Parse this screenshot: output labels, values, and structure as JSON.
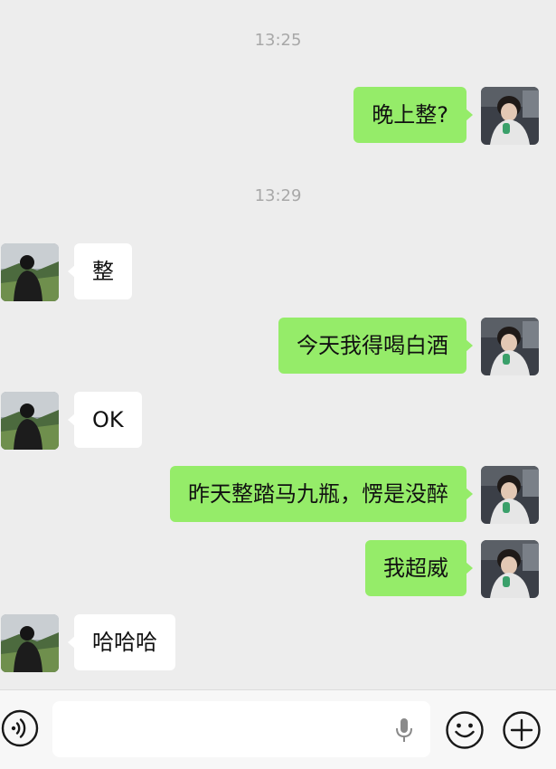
{
  "chat": {
    "timestamps": [
      "13:25",
      "13:29"
    ],
    "messages": [
      {
        "sender": "me",
        "text": "晚上整?"
      },
      {
        "sender": "other",
        "text": "整"
      },
      {
        "sender": "me",
        "text": "今天我得喝白酒"
      },
      {
        "sender": "other",
        "text": "OK"
      },
      {
        "sender": "me",
        "text": "昨天整踏马九瓶，愣是没醉"
      },
      {
        "sender": "me",
        "text": "我超威"
      },
      {
        "sender": "other",
        "text": "哈哈哈"
      }
    ]
  },
  "input_bar": {
    "voice_icon": "voice-icon",
    "mic_icon": "microphone-icon",
    "emoji_icon": "emoji-icon",
    "plus_icon": "plus-icon"
  },
  "colors": {
    "background": "#ededed",
    "my_bubble": "#95ec69",
    "their_bubble": "#ffffff",
    "timestamp": "#a8a8a8"
  }
}
